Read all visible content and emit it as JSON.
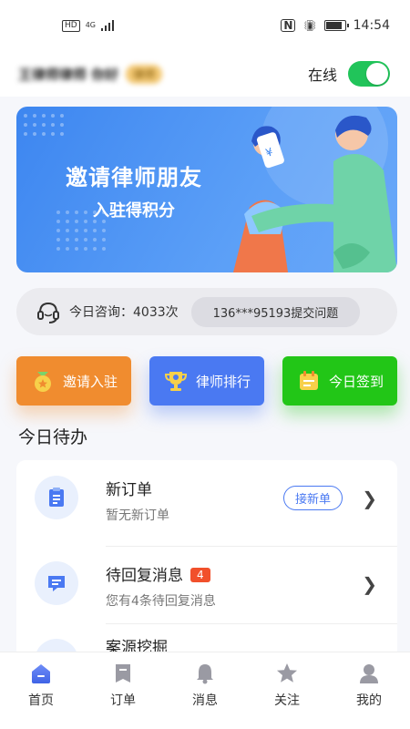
{
  "status_bar": {
    "hd": "HD",
    "network": "4G",
    "nfc": "N",
    "time": "14:54"
  },
  "header": {
    "greeting_name": "王律师律师 你好",
    "greeting_badge": "律师",
    "online_label": "在线",
    "online": true
  },
  "banner": {
    "title": "邀请律师朋友",
    "subtitle": "入驻得积分"
  },
  "consult": {
    "label": "今日咨询：4033次",
    "ticker": "136***95193提交问题"
  },
  "actions": [
    {
      "label": "邀请入驻",
      "icon": "medal-icon",
      "color": "#f08c2f"
    },
    {
      "label": "律师排行",
      "icon": "trophy-icon",
      "color": "#4a79f2"
    },
    {
      "label": "今日签到",
      "icon": "calendar-icon",
      "color": "#22c617"
    }
  ],
  "todo": {
    "title": "今日待办",
    "items": [
      {
        "title": "新订单",
        "subtitle": "暂无新订单",
        "button": "接新单",
        "icon": "clipboard-icon"
      },
      {
        "title": "待回复消息",
        "subtitle": "您有4条待回复消息",
        "badge": "4",
        "icon": "message-icon"
      },
      {
        "title": "案源挖掘",
        "icon": "search-icon"
      }
    ]
  },
  "nav": {
    "items": [
      {
        "label": "首页",
        "icon": "home-icon",
        "active": true
      },
      {
        "label": "订单",
        "icon": "order-icon"
      },
      {
        "label": "消息",
        "icon": "bell-icon"
      },
      {
        "label": "关注",
        "icon": "star-icon"
      },
      {
        "label": "我的",
        "icon": "user-icon"
      }
    ]
  },
  "colors": {
    "accent": "#4a79f2",
    "online_green": "#21c45a",
    "orange": "#f08c2f",
    "green": "#22c617",
    "badge_red": "#f1502b"
  }
}
